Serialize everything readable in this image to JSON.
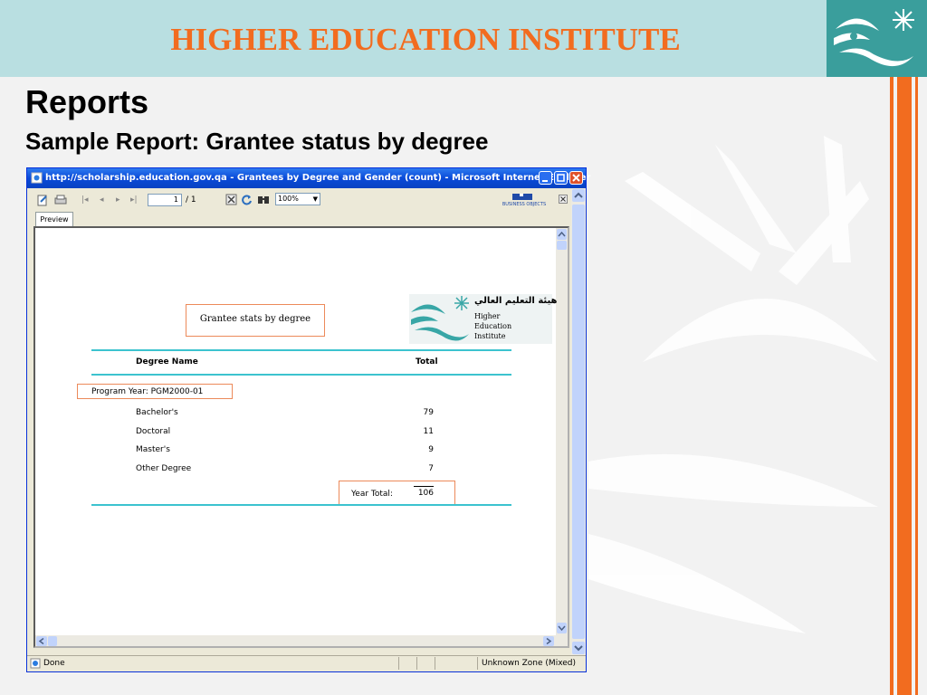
{
  "slide": {
    "institute_title": "HIGHER EDUCATION INSTITUTE",
    "title": "Reports",
    "subtitle": "Sample Report: Grantee status by degree"
  },
  "colors": {
    "accent": "#f26c1f",
    "header_bg": "#b9dfe1",
    "logo_bg": "#3a9e9c",
    "rule": "#3cc3cf"
  },
  "browser": {
    "title": "http://scholarship.education.gov.qa - Grantees by Degree and Gender (count) - Microsoft Internet Explorer",
    "toolbar": {
      "page_current": "1",
      "page_total": "/ 1",
      "zoom": "100%",
      "brand": "BUSINESS OBJECTS"
    },
    "tab": "Preview",
    "status_left": "Done",
    "status_right": "Unknown Zone (Mixed)"
  },
  "report": {
    "heading": "Grantee stats by degree",
    "logo": {
      "arabic": "هيئة التعليم العالي",
      "line1": "Higher",
      "line2": "Education",
      "line3": "Institute"
    },
    "columns": [
      "Degree Name",
      "Total"
    ],
    "group_label": "Program Year: PGM2000-01",
    "rows": [
      {
        "name": "Bachelor's",
        "total": "79"
      },
      {
        "name": "Doctoral",
        "total": "11"
      },
      {
        "name": "Master's",
        "total": "9"
      },
      {
        "name": "Other Degree",
        "total": "7"
      }
    ],
    "year_total_label": "Year Total:",
    "year_total_value": "106"
  }
}
